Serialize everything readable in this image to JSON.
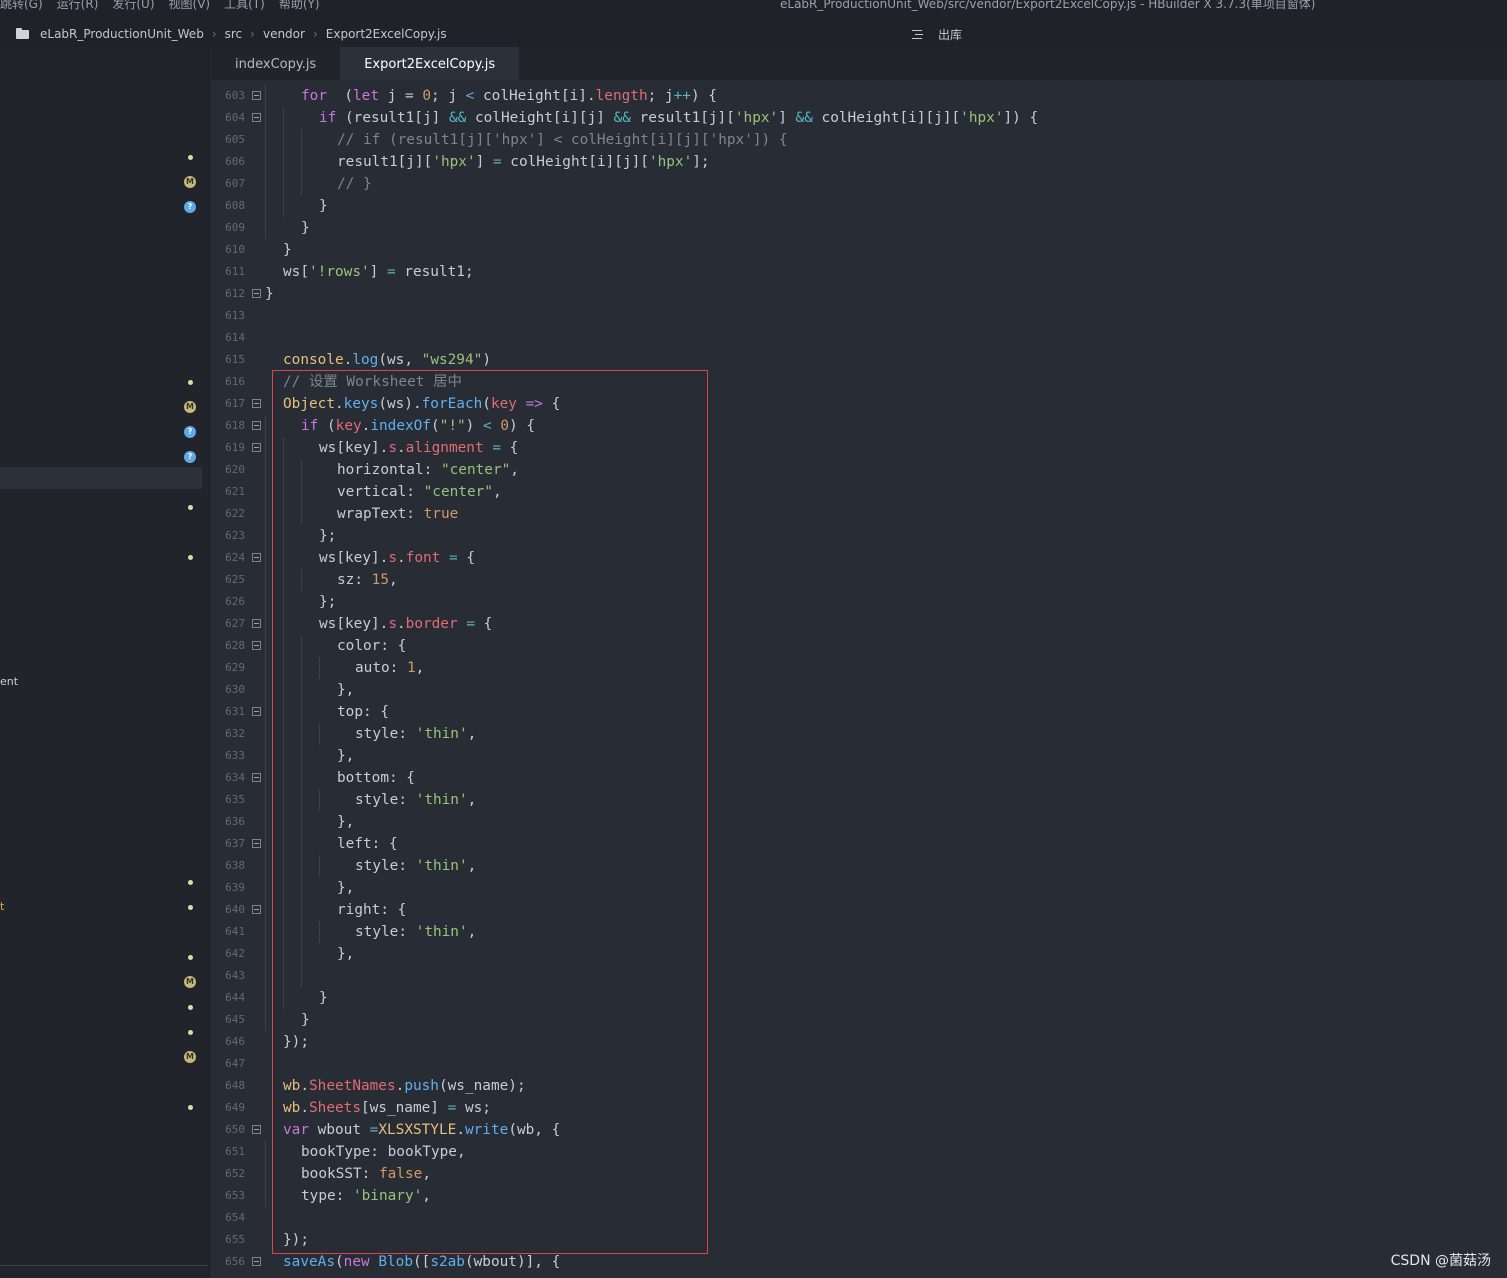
{
  "titlebar": {
    "menus": [
      "跳转(G)",
      "运行(R)",
      "发行(U)",
      "视图(V)",
      "工具(T)",
      "帮助(Y)"
    ],
    "window_title": "eLabR_ProductionUnit_Web/src/vendor/Export2ExcelCopy.js - HBuilder X 3.7.3(单项目窗体)"
  },
  "breadcrumb": {
    "items": [
      "eLabR_ProductionUnit_Web",
      "src",
      "vendor",
      "Export2ExcelCopy.js"
    ],
    "outline_label": "出库"
  },
  "sidebar": {
    "fragments": [
      "ent",
      "t"
    ],
    "markers": [
      {
        "type": "dot"
      },
      {
        "type": "m",
        "label": "M"
      },
      {
        "type": "q",
        "label": "?"
      },
      {
        "type": "dot"
      },
      {
        "type": "m",
        "label": "M"
      },
      {
        "type": "q",
        "label": "?"
      },
      {
        "type": "q",
        "label": "?"
      },
      {
        "type": "dot"
      },
      {
        "type": "dot"
      },
      {
        "type": "dot"
      },
      {
        "type": "dot"
      },
      {
        "type": "dot"
      },
      {
        "type": "m",
        "label": "M"
      },
      {
        "type": "dot"
      },
      {
        "type": "dot"
      },
      {
        "type": "m",
        "label": "M"
      },
      {
        "type": "dot"
      }
    ]
  },
  "tabs": [
    {
      "label": "indexCopy.js",
      "active": false
    },
    {
      "label": "Export2ExcelCopy.js",
      "active": true
    }
  ],
  "editor": {
    "first_line": 603,
    "lines": [
      {
        "indent": 2,
        "fold": true,
        "t": [
          [
            "kw",
            "for"
          ],
          [
            "",
            "  ("
          ],
          [
            "kw",
            "let"
          ],
          [
            "",
            " j = "
          ],
          [
            "nm",
            "0"
          ],
          [
            "",
            "; j "
          ],
          [
            "op",
            "<"
          ],
          [
            "",
            " colHeight[i]."
          ],
          [
            "pr",
            "length"
          ],
          [
            "",
            "; j"
          ],
          [
            "op",
            "++"
          ],
          [
            "",
            ") {"
          ]
        ]
      },
      {
        "indent": 3,
        "fold": true,
        "t": [
          [
            "kw",
            "if"
          ],
          [
            "",
            " (result1[j] "
          ],
          [
            "op",
            "&&"
          ],
          [
            "",
            " colHeight[i][j] "
          ],
          [
            "op",
            "&&"
          ],
          [
            "",
            " result1[j]["
          ],
          [
            "st",
            "'hpx'"
          ],
          [
            "",
            "] "
          ],
          [
            "op",
            "&&"
          ],
          [
            "",
            " colHeight[i][j]["
          ],
          [
            "st",
            "'hpx'"
          ],
          [
            "",
            "]) {"
          ]
        ]
      },
      {
        "indent": 4,
        "fold": false,
        "t": [
          [
            "cm",
            "// if (result1[j]['hpx'] < colHeight[i][j]['hpx']) {"
          ]
        ]
      },
      {
        "indent": 4,
        "fold": false,
        "t": [
          [
            "",
            "result1[j]["
          ],
          [
            "st",
            "'hpx'"
          ],
          [
            "",
            "] "
          ],
          [
            "op",
            "="
          ],
          [
            "",
            " colHeight[i][j]["
          ],
          [
            "st",
            "'hpx'"
          ],
          [
            "",
            "];"
          ]
        ]
      },
      {
        "indent": 4,
        "fold": false,
        "t": [
          [
            "cm",
            "// }"
          ]
        ]
      },
      {
        "indent": 3,
        "fold": false,
        "t": [
          [
            "",
            "}"
          ]
        ]
      },
      {
        "indent": 2,
        "fold": false,
        "t": [
          [
            "",
            "}"
          ]
        ]
      },
      {
        "indent": 1,
        "fold": false,
        "t": [
          [
            "",
            "}"
          ]
        ]
      },
      {
        "indent": 1,
        "fold": false,
        "t": [
          [
            "",
            "ws["
          ],
          [
            "st",
            "'!rows'"
          ],
          [
            "",
            "] "
          ],
          [
            "op",
            "="
          ],
          [
            "",
            " result1;"
          ]
        ]
      },
      {
        "indent": 0,
        "fold": true,
        "t": [
          [
            "",
            "}"
          ]
        ]
      },
      {
        "indent": 1,
        "fold": false,
        "t": []
      },
      {
        "indent": 1,
        "fold": false,
        "t": []
      },
      {
        "indent": 1,
        "fold": false,
        "t": [
          [
            "cl",
            "console"
          ],
          [
            "",
            "."
          ],
          [
            "fn",
            "log"
          ],
          [
            "",
            "(ws, "
          ],
          [
            "st",
            "\"ws294\""
          ],
          [
            "",
            ")"
          ]
        ]
      },
      {
        "indent": 1,
        "fold": false,
        "t": [
          [
            "cm",
            "// 设置 Worksheet 居中"
          ]
        ]
      },
      {
        "indent": 1,
        "fold": true,
        "t": [
          [
            "cl",
            "Object"
          ],
          [
            "",
            "."
          ],
          [
            "fn",
            "keys"
          ],
          [
            "",
            "(ws)."
          ],
          [
            "fn",
            "forEach"
          ],
          [
            "",
            "("
          ],
          [
            "pr",
            "key"
          ],
          [
            "",
            " "
          ],
          [
            "kw",
            "=>"
          ],
          [
            "",
            " {"
          ]
        ]
      },
      {
        "indent": 2,
        "fold": true,
        "t": [
          [
            "kw",
            "if"
          ],
          [
            "",
            " ("
          ],
          [
            "pr",
            "key"
          ],
          [
            "",
            "."
          ],
          [
            "fn",
            "indexOf"
          ],
          [
            "",
            "("
          ],
          [
            "st",
            "\"!\""
          ],
          [
            "",
            ") "
          ],
          [
            "op",
            "<"
          ],
          [
            "",
            " "
          ],
          [
            "nm",
            "0"
          ],
          [
            "",
            ") {"
          ]
        ]
      },
      {
        "indent": 3,
        "fold": true,
        "t": [
          [
            "",
            "ws[key]."
          ],
          [
            "pr",
            "s"
          ],
          [
            "",
            "."
          ],
          [
            "pr",
            "alignment"
          ],
          [
            "",
            " "
          ],
          [
            "op",
            "="
          ],
          [
            "",
            " {"
          ]
        ]
      },
      {
        "indent": 4,
        "fold": false,
        "t": [
          [
            "",
            "horizontal: "
          ],
          [
            "st",
            "\"center\""
          ],
          [
            "",
            ","
          ]
        ]
      },
      {
        "indent": 4,
        "fold": false,
        "t": [
          [
            "",
            "vertical: "
          ],
          [
            "st",
            "\"center\""
          ],
          [
            "",
            ","
          ]
        ]
      },
      {
        "indent": 4,
        "fold": false,
        "t": [
          [
            "",
            "wrapText: "
          ],
          [
            "nm",
            "true"
          ]
        ]
      },
      {
        "indent": 3,
        "fold": false,
        "t": [
          [
            "",
            "};"
          ]
        ]
      },
      {
        "indent": 3,
        "fold": true,
        "t": [
          [
            "",
            "ws[key]."
          ],
          [
            "pr",
            "s"
          ],
          [
            "",
            "."
          ],
          [
            "pr",
            "font"
          ],
          [
            "",
            " "
          ],
          [
            "op",
            "="
          ],
          [
            "",
            " {"
          ]
        ]
      },
      {
        "indent": 4,
        "fold": false,
        "t": [
          [
            "",
            "sz: "
          ],
          [
            "nm",
            "15"
          ],
          [
            "",
            ","
          ]
        ]
      },
      {
        "indent": 3,
        "fold": false,
        "t": [
          [
            "",
            "};"
          ]
        ]
      },
      {
        "indent": 3,
        "fold": true,
        "t": [
          [
            "",
            "ws[key]."
          ],
          [
            "pr",
            "s"
          ],
          [
            "",
            "."
          ],
          [
            "pr",
            "border"
          ],
          [
            "",
            " "
          ],
          [
            "op",
            "="
          ],
          [
            "",
            " {"
          ]
        ]
      },
      {
        "indent": 4,
        "fold": true,
        "t": [
          [
            "",
            "color: {"
          ]
        ]
      },
      {
        "indent": 5,
        "fold": false,
        "t": [
          [
            "",
            "auto: "
          ],
          [
            "nm",
            "1"
          ],
          [
            "",
            ","
          ]
        ]
      },
      {
        "indent": 4,
        "fold": false,
        "t": [
          [
            "",
            "},"
          ]
        ]
      },
      {
        "indent": 4,
        "fold": true,
        "t": [
          [
            "",
            "top: {"
          ]
        ]
      },
      {
        "indent": 5,
        "fold": false,
        "t": [
          [
            "",
            "style: "
          ],
          [
            "st",
            "'thin'"
          ],
          [
            "",
            ","
          ]
        ]
      },
      {
        "indent": 4,
        "fold": false,
        "t": [
          [
            "",
            "},"
          ]
        ]
      },
      {
        "indent": 4,
        "fold": true,
        "t": [
          [
            "",
            "bottom: {"
          ]
        ]
      },
      {
        "indent": 5,
        "fold": false,
        "t": [
          [
            "",
            "style: "
          ],
          [
            "st",
            "'thin'"
          ],
          [
            "",
            ","
          ]
        ]
      },
      {
        "indent": 4,
        "fold": false,
        "t": [
          [
            "",
            "},"
          ]
        ]
      },
      {
        "indent": 4,
        "fold": true,
        "t": [
          [
            "",
            "left: {"
          ]
        ]
      },
      {
        "indent": 5,
        "fold": false,
        "t": [
          [
            "",
            "style: "
          ],
          [
            "st",
            "'thin'"
          ],
          [
            "",
            ","
          ]
        ]
      },
      {
        "indent": 4,
        "fold": false,
        "t": [
          [
            "",
            "},"
          ]
        ]
      },
      {
        "indent": 4,
        "fold": true,
        "t": [
          [
            "",
            "right: {"
          ]
        ]
      },
      {
        "indent": 5,
        "fold": false,
        "t": [
          [
            "",
            "style: "
          ],
          [
            "st",
            "'thin'"
          ],
          [
            "",
            ","
          ]
        ]
      },
      {
        "indent": 4,
        "fold": false,
        "t": [
          [
            "",
            "},"
          ]
        ]
      },
      {
        "indent": 4,
        "fold": false,
        "t": []
      },
      {
        "indent": 3,
        "fold": false,
        "t": [
          [
            "",
            "}"
          ]
        ]
      },
      {
        "indent": 2,
        "fold": false,
        "t": [
          [
            "",
            "}"
          ]
        ]
      },
      {
        "indent": 1,
        "fold": false,
        "t": [
          [
            "",
            "});"
          ]
        ]
      },
      {
        "indent": 1,
        "fold": false,
        "t": []
      },
      {
        "indent": 1,
        "fold": false,
        "t": [
          [
            "cl",
            "wb"
          ],
          [
            "",
            "."
          ],
          [
            "pr",
            "SheetNames"
          ],
          [
            "",
            "."
          ],
          [
            "fn",
            "push"
          ],
          [
            "",
            "(ws_name);"
          ]
        ]
      },
      {
        "indent": 1,
        "fold": false,
        "t": [
          [
            "cl",
            "wb"
          ],
          [
            "",
            "."
          ],
          [
            "pr",
            "Sheets"
          ],
          [
            "",
            "[ws_name] "
          ],
          [
            "op",
            "="
          ],
          [
            "",
            " ws;"
          ]
        ]
      },
      {
        "indent": 1,
        "fold": true,
        "t": [
          [
            "kw",
            "var"
          ],
          [
            "",
            " wbout "
          ],
          [
            "op",
            "="
          ],
          [
            " ",
            ""
          ],
          [
            "cl",
            "XLSXSTYLE"
          ],
          [
            "",
            "."
          ],
          [
            "fn",
            "write"
          ],
          [
            "",
            "(wb, {"
          ]
        ]
      },
      {
        "indent": 2,
        "fold": false,
        "t": [
          [
            "",
            "bookType: bookType,"
          ]
        ]
      },
      {
        "indent": 2,
        "fold": false,
        "t": [
          [
            "",
            "bookSST: "
          ],
          [
            "nm",
            "false"
          ],
          [
            "",
            ","
          ]
        ]
      },
      {
        "indent": 2,
        "fold": false,
        "t": [
          [
            "",
            "type: "
          ],
          [
            "st",
            "'binary'"
          ],
          [
            "",
            ","
          ]
        ]
      },
      {
        "indent": 1,
        "fold": false,
        "t": []
      },
      {
        "indent": 1,
        "fold": false,
        "t": [
          [
            "",
            "});"
          ]
        ]
      },
      {
        "indent": 1,
        "fold": true,
        "t": [
          [
            "fn",
            "saveAs"
          ],
          [
            "",
            "("
          ],
          [
            "kw",
            "new"
          ],
          [
            "",
            " "
          ],
          [
            "fn",
            "Blob"
          ],
          [
            "",
            "(["
          ],
          [
            "fn",
            "s2ab"
          ],
          [
            "",
            "(wbout)], {"
          ]
        ]
      }
    ]
  },
  "watermark": "CSDN @菌菇汤"
}
